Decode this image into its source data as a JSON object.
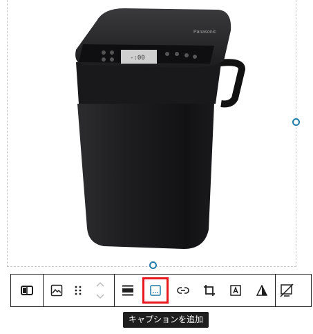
{
  "image": {
    "alt": "Panasonic bread maker (black)",
    "brand_text": "Panasonic",
    "colors": {
      "body": "#1c1c1e",
      "top": "#2a2a2c",
      "panel": "#111113",
      "lcd": "#c9c9c9"
    }
  },
  "toolbar": {
    "groups": [
      {
        "items": [
          {
            "icon": "columns-icon",
            "name": "block-type-button"
          }
        ]
      },
      {
        "items": [
          {
            "icon": "image-icon",
            "name": "image-button"
          },
          {
            "icon": "drag-handle-icon",
            "name": "drag-handle"
          },
          {
            "icon": "move-up-down-icon",
            "name": "move-buttons"
          }
        ]
      },
      {
        "items": [
          {
            "icon": "align-icon",
            "name": "align-button"
          },
          {
            "icon": "caption-icon",
            "name": "add-caption-button"
          },
          {
            "icon": "link-icon",
            "name": "link-button"
          },
          {
            "icon": "crop-icon",
            "name": "crop-button"
          },
          {
            "icon": "text-overlay-icon",
            "name": "text-overlay-button"
          },
          {
            "icon": "duotone-icon",
            "name": "duotone-button"
          }
        ]
      },
      {
        "items": [
          {
            "icon": "replace-icon",
            "name": "replace-button"
          }
        ]
      }
    ]
  },
  "tooltip": {
    "text": "キャプションを追加"
  },
  "highlight_color": "#e8161b",
  "handle_color": "#1e7ba8"
}
